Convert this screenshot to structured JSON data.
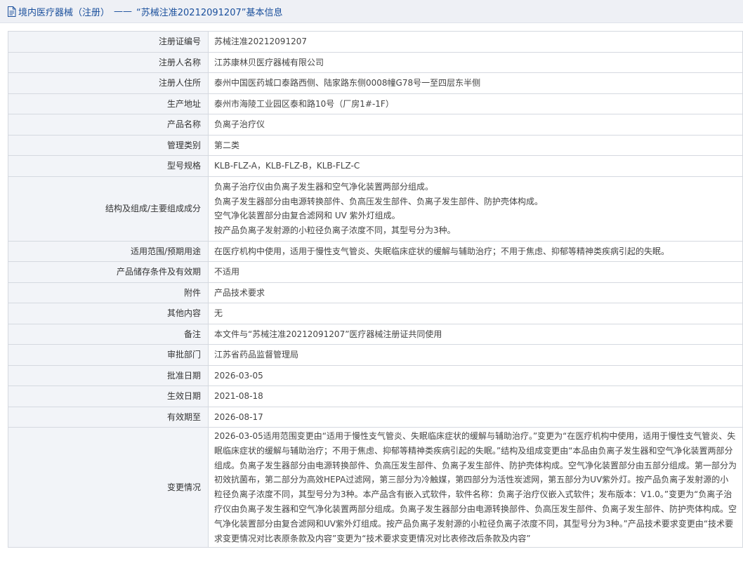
{
  "header": {
    "category": "境内医疗器械（注册）",
    "separator": "——",
    "title": "“苏械注准20212091207”基本信息"
  },
  "rows": [
    {
      "label": "注册证编号",
      "value": "苏械注准20212091207"
    },
    {
      "label": "注册人名称",
      "value": "江苏康林贝医疗器械有限公司"
    },
    {
      "label": "注册人住所",
      "value": "泰州中国医药城口泰路西侧、陆家路东侧0008幢G78号一至四层东半侧"
    },
    {
      "label": "生产地址",
      "value": "泰州市海陵工业园区泰和路10号（厂房1#-1F）"
    },
    {
      "label": "产品名称",
      "value": "负离子治疗仪"
    },
    {
      "label": "管理类别",
      "value": "第二类"
    },
    {
      "label": "型号规格",
      "value": "KLB-FLZ-A，KLB-FLZ-B，KLB-FLZ-C"
    },
    {
      "label": "结构及组成/主要组成成分",
      "lines": [
        "负离子治疗仪由负离子发生器和空气净化装置两部分组成。",
        "负离子发生器部分由电源转换部件、负高压发生部件、负离子发生部件、防护壳体构成。",
        "空气净化装置部分由复合滤网和 UV 紫外灯组成。",
        "按产品负离子发射源的小粒径负离子浓度不同，其型号分为3种。"
      ]
    },
    {
      "label": "适用范围/预期用途",
      "value": "在医疗机构中使用，适用于慢性支气管炎、失眠临床症状的缓解与辅助治疗；不用于焦虑、抑郁等精神类疾病引起的失眠。"
    },
    {
      "label": "产品储存条件及有效期",
      "value": "不适用"
    },
    {
      "label": "附件",
      "value": "产品技术要求"
    },
    {
      "label": "其他内容",
      "value": "无"
    },
    {
      "label": "备注",
      "value": "本文件与“苏械注准20212091207”医疗器械注册证共同使用"
    },
    {
      "label": "审批部门",
      "value": "江苏省药品监督管理局"
    },
    {
      "label": "批准日期",
      "value": "2026-03-05"
    },
    {
      "label": "生效日期",
      "value": "2021-08-18"
    },
    {
      "label": "有效期至",
      "value": "2026-08-17"
    },
    {
      "label": "变更情况",
      "value": "2026-03-05适用范围变更由“适用于慢性支气管炎、失眠临床症状的缓解与辅助治疗。”变更为“在医疗机构中使用，适用于慢性支气管炎、失眠临床症状的缓解与辅助治疗；不用于焦虑、抑郁等精神类疾病引起的失眠。”结构及组成变更由“本品由负离子发生器和空气净化装置两部分组成。负离子发生器部分由电源转换部件、负高压发生部件、负离子发生部件、防护壳体构成。空气净化装置部分由五部分组成。第一部分为初效抗菌布，第二部分为高效HEPA过滤网，第三部分为冷触媒，第四部分为活性炭滤网，第五部分为UV紫外灯。按产品负离子发射源的小粒径负离子浓度不同，其型号分为3种。本产品含有嵌入式软件，软件名称：负离子治疗仪嵌入式软件；发布版本：V1.0。”变更为“负离子治疗仪由负离子发生器和空气净化装置两部分组成。负离子发生器部分由电源转换部件、负高压发生部件、负离子发生部件、防护壳体构成。空气净化装置部分由复合滤网和UV紫外灯组成。按产品负离子发射源的小粒径负离子浓度不同，其型号分为3种。”产品技术要求变更由“技术要求变更情况对比表原条款及内容”变更为“技术要求变更情况对比表修改后条款及内容”"
    }
  ]
}
